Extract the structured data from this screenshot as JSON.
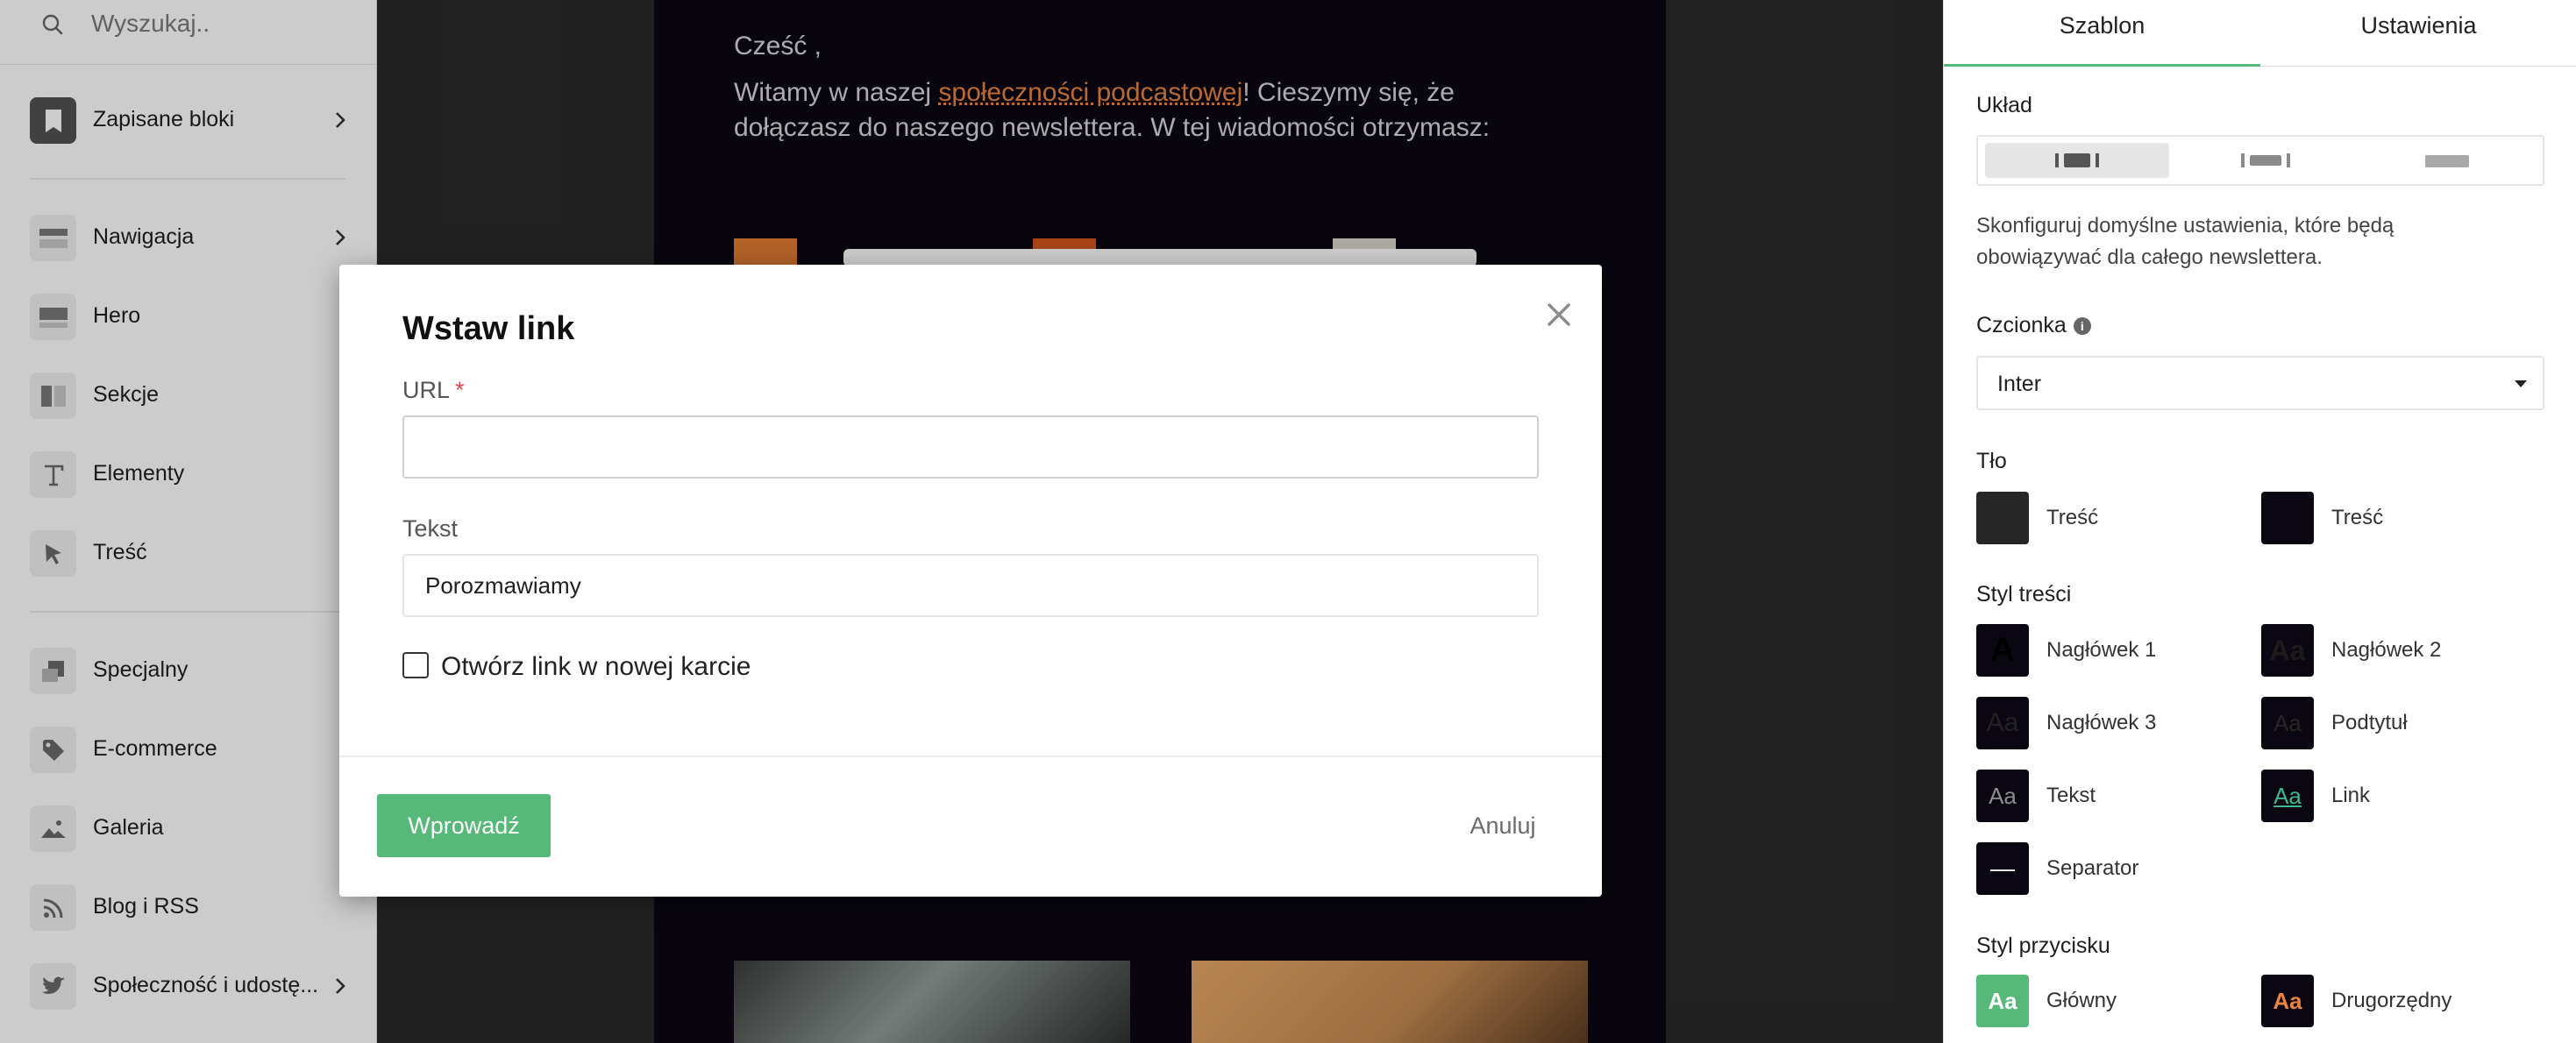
{
  "sidebar": {
    "search_placeholder": "Wyszukaj..",
    "items": [
      {
        "label": "Zapisane bloki",
        "icon": "bookmark-icon"
      },
      {
        "label": "Nawigacja",
        "icon": "navigation-icon"
      },
      {
        "label": "Hero",
        "icon": "hero-icon"
      },
      {
        "label": "Sekcje",
        "icon": "sections-icon"
      },
      {
        "label": "Elementy",
        "icon": "text-icon"
      },
      {
        "label": "Treść",
        "icon": "cursor-icon"
      },
      {
        "label": "Specjalny",
        "icon": "special-icon"
      },
      {
        "label": "E-commerce",
        "icon": "tag-icon"
      },
      {
        "label": "Galeria",
        "icon": "image-icon"
      },
      {
        "label": "Blog i RSS",
        "icon": "rss-icon"
      },
      {
        "label": "Społeczność i udostę...",
        "icon": "twitter-icon"
      }
    ]
  },
  "preview": {
    "greeting": "Cześć ,",
    "intro_before": "Witamy w naszej ",
    "intro_link": "społeczności podcastowej",
    "intro_after": "! Cieszymy się, że dołączasz do naszego newslettera. W tej wiadomości otrzymasz:"
  },
  "modal": {
    "title": "Wstaw link",
    "url_label": "URL",
    "url_required_mark": "*",
    "url_value": "",
    "text_label": "Tekst",
    "text_value": "Porozmawiamy",
    "new_tab_label": "Otwórz link w nowej karcie",
    "new_tab_checked": false,
    "submit_label": "Wprowadź",
    "cancel_label": "Anuluj"
  },
  "panel": {
    "tabs": [
      {
        "label": "Szablon",
        "active": true
      },
      {
        "label": "Ustawienia",
        "active": false
      }
    ],
    "layout_heading": "Układ",
    "layout_selected": "center",
    "description": "Skonfiguruj domyślne ustawienia, które będą obowiązywać dla całego newslettera.",
    "font_heading": "Czcionka",
    "font_value": "Inter",
    "background_heading": "Tło",
    "backgrounds": [
      {
        "label": "Treść",
        "color": "#262626"
      },
      {
        "label": "Treść",
        "color": "#0b0712"
      }
    ],
    "content_style_heading": "Styl treści",
    "content_styles": [
      {
        "label": "Nagłówek 1",
        "sample": "A",
        "fg": "#000000"
      },
      {
        "label": "Nagłówek 2",
        "sample": "Aa",
        "fg": "#1b1b1b"
      },
      {
        "label": "Nagłówek 3",
        "sample": "Aa",
        "fg": "#222222"
      },
      {
        "label": "Podtytuł",
        "sample": "Aa",
        "fg": "#262626"
      },
      {
        "label": "Tekst",
        "sample": "Aa",
        "fg": "#8c8c8c"
      },
      {
        "label": "Link",
        "sample": "Aa",
        "fg": "#3fb58f"
      },
      {
        "label": "Separator",
        "sample": "—",
        "fg": "#ffffff"
      }
    ],
    "button_style_heading": "Styl przycisku",
    "button_styles": [
      {
        "label": "Główny",
        "sample": "Aa",
        "bg": "#56b879",
        "fg": "#ffffff"
      },
      {
        "label": "Drugorzędny",
        "sample": "Aa",
        "bg": "#0b0712",
        "fg": "#e8843f"
      }
    ]
  },
  "colors": {
    "accent": "#56b879",
    "link_orange": "#e8843f",
    "email_bg": "#0b0712"
  }
}
